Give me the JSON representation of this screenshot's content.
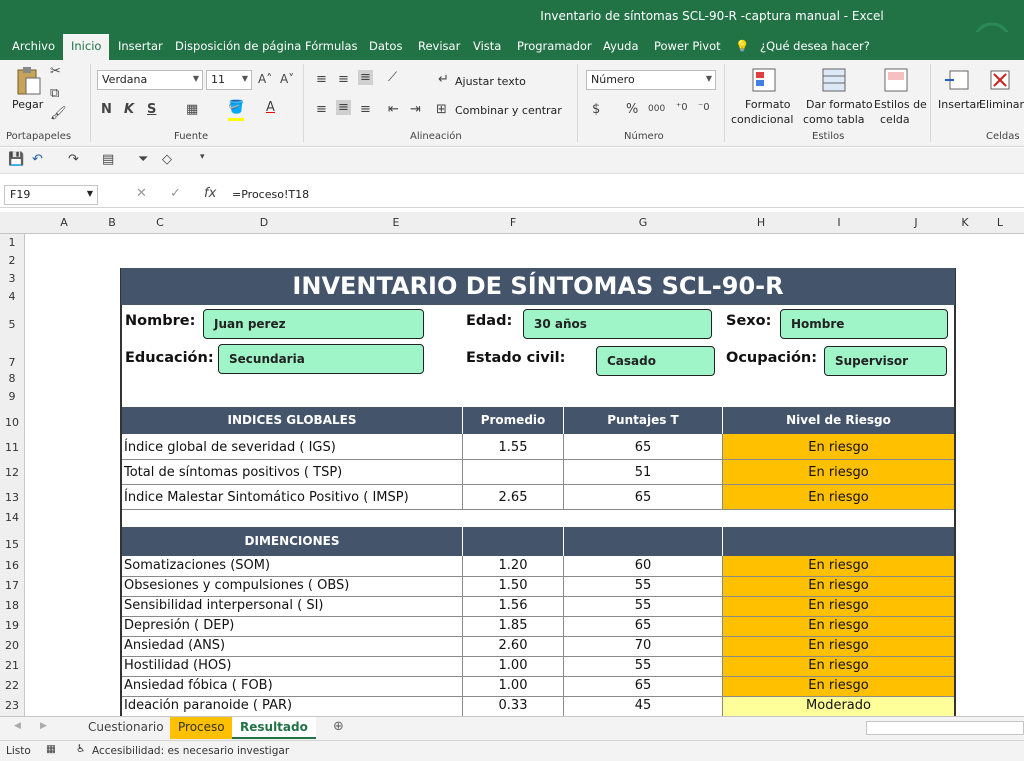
{
  "window": {
    "title": "Inventario de síntomas SCL-90-R -captura manual  -  Excel"
  },
  "menu": {
    "tabs": [
      "Archivo",
      "Inicio",
      "Insertar",
      "Disposición de página",
      "Fórmulas",
      "Datos",
      "Revisar",
      "Vista",
      "Programador",
      "Ayuda",
      "Power Pivot"
    ],
    "active": "Inicio",
    "tell_me": "¿Qué desea hacer?"
  },
  "ribbon": {
    "paste_label": "Pegar",
    "font_name": "Verdana",
    "font_size": "11",
    "bold": "N",
    "italic": "K",
    "underline": "S",
    "wrap_text": "Ajustar texto",
    "merge_center": "Combinar y centrar",
    "number_format": "Número",
    "currency": "$",
    "percent": "%",
    "thousands": "000",
    "cond_format": [
      "Formato",
      "condicional"
    ],
    "table_format": [
      "Dar formato",
      "como tabla"
    ],
    "cell_styles": [
      "Estilos de",
      "celda"
    ],
    "insert": "Insertar",
    "delete": "Eliminar",
    "groups": [
      "Portapapeles",
      "Fuente",
      "Alineación",
      "Número",
      "Estilos",
      "Celdas"
    ]
  },
  "formula_bar": {
    "name_box": "F19",
    "fx": "fx",
    "formula": "=Proceso!T18"
  },
  "columns": [
    "A",
    "B",
    "C",
    "D",
    "E",
    "F",
    "G",
    "H",
    "I",
    "J",
    "K",
    "L"
  ],
  "rows": [
    "1",
    "2",
    "3",
    "4",
    "5",
    "6",
    "7",
    "8",
    "9",
    "10",
    "11",
    "12",
    "13",
    "14",
    "15",
    "16",
    "17",
    "18",
    "19",
    "20",
    "21",
    "22",
    "23"
  ],
  "form": {
    "title": "INVENTARIO DE SÍNTOMAS SCL-90-R",
    "nombre_label": "Nombre:",
    "nombre": "Juan perez",
    "edad_label": "Edad:",
    "edad": "30 años",
    "sexo_label": "Sexo:",
    "sexo": "Hombre",
    "educacion_label": "Educación:",
    "educacion": "Secundaria",
    "estado_label": "Estado civil:",
    "estado": "Casado",
    "ocupacion_label": "Ocupación:",
    "ocupacion": "Supervisor"
  },
  "global_table": {
    "headers": [
      "INDICES GLOBALES",
      "Promedio",
      "Puntajes T",
      "Nivel de Riesgo"
    ],
    "rows": [
      {
        "name": "Índice global de severidad ( IGS)",
        "prom": "1.55",
        "t": "65",
        "risk": "En riesgo"
      },
      {
        "name": "Total de síntomas positivos ( TSP)",
        "prom": "",
        "t": "51",
        "risk": "En riesgo"
      },
      {
        "name": "Índice Malestar Sintomático Positivo ( IMSP)",
        "prom": "2.65",
        "t": "65",
        "risk": "En riesgo"
      }
    ]
  },
  "dim_table": {
    "header": "DIMENCIONES",
    "rows": [
      {
        "name": "Somatizaciones (SOM)",
        "prom": "1.20",
        "t": "60",
        "risk": "En riesgo"
      },
      {
        "name": "Obsesiones y compulsiones ( OBS)",
        "prom": "1.50",
        "t": "55",
        "risk": "En riesgo"
      },
      {
        "name": "Sensibilidad interpersonal ( SI)",
        "prom": "1.56",
        "t": "55",
        "risk": "En riesgo"
      },
      {
        "name": "Depresión ( DEP)",
        "prom": "1.85",
        "t": "65",
        "risk": "En riesgo"
      },
      {
        "name": "Ansiedad (ANS)",
        "prom": "2.60",
        "t": "70",
        "risk": "En riesgo"
      },
      {
        "name": "Hostilidad (HOS)",
        "prom": "1.00",
        "t": "55",
        "risk": "En riesgo"
      },
      {
        "name": "Ansiedad fóbica ( FOB)",
        "prom": "1.00",
        "t": "65",
        "risk": "En riesgo"
      },
      {
        "name": "Ideación paranoide ( PAR)",
        "prom": "0.33",
        "t": "45",
        "risk": "Moderado"
      }
    ]
  },
  "colors": {
    "risk_high": "#ffc000",
    "risk_moderate": "#ffff99",
    "header_bg": "#44546a",
    "field_bg": "#9ff5c8",
    "excel_green": "#217346"
  },
  "sheet_tabs": [
    "Cuestionario",
    "Proceso",
    "Resultado"
  ],
  "status": {
    "ready": "Listo",
    "accessibility": "Accesibilidad: es necesario investigar"
  }
}
